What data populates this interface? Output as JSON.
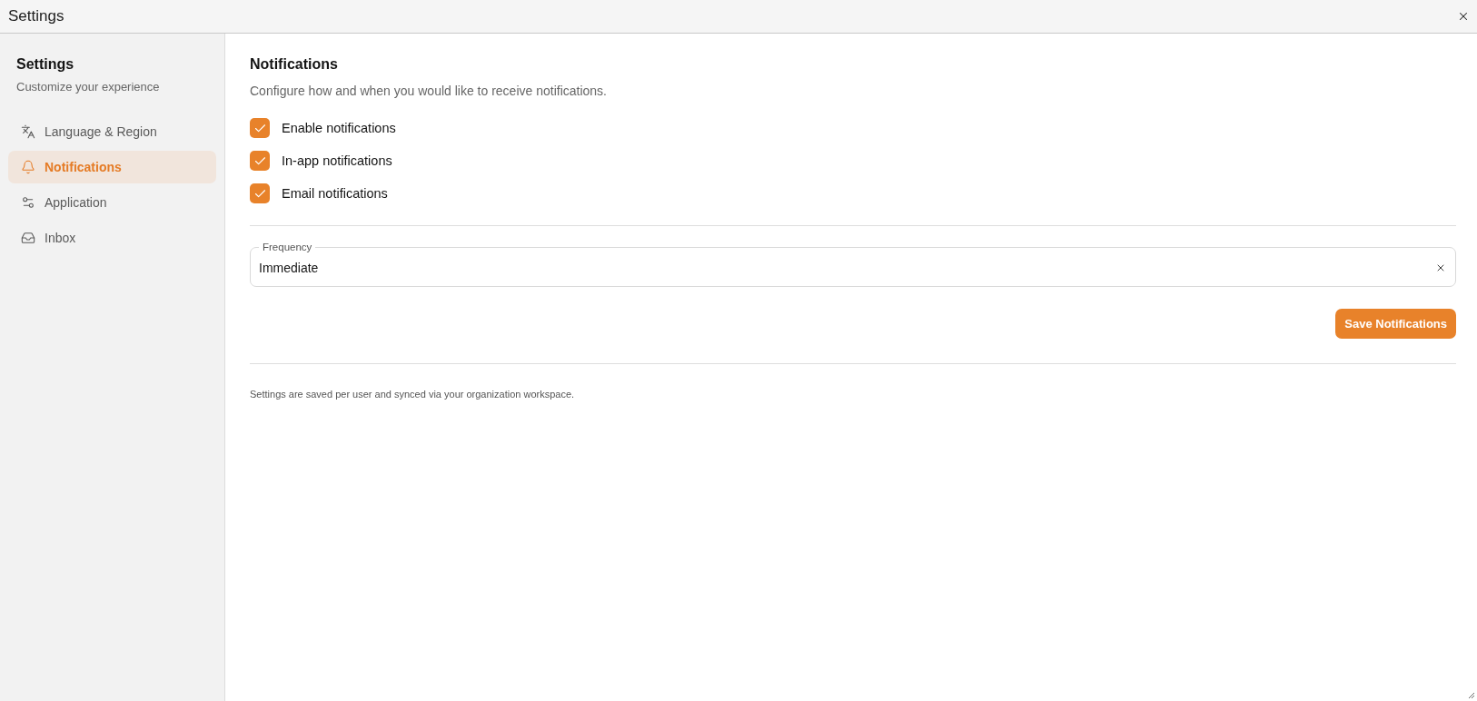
{
  "window": {
    "title": "Settings"
  },
  "sidebar": {
    "title": "Settings",
    "subtitle": "Customize your experience",
    "items": [
      {
        "label": "Language & Region",
        "kind": "language",
        "selected": false
      },
      {
        "label": "Notifications",
        "kind": "bell",
        "selected": true
      },
      {
        "label": "Application",
        "kind": "sliders",
        "selected": false
      },
      {
        "label": "Inbox",
        "kind": "inbox",
        "selected": false
      }
    ]
  },
  "main": {
    "title": "Notifications",
    "description": "Configure how and when you would like to receive notifications.",
    "options": [
      {
        "label": "Enable notifications",
        "checked": true
      },
      {
        "label": "In-app notifications",
        "checked": true
      },
      {
        "label": "Email notifications",
        "checked": true
      }
    ],
    "frequency": {
      "label": "Frequency",
      "value": "Immediate"
    },
    "save_button": "Save Notifications",
    "footer_note": "Settings are saved per user and synced via your organization workspace."
  }
}
